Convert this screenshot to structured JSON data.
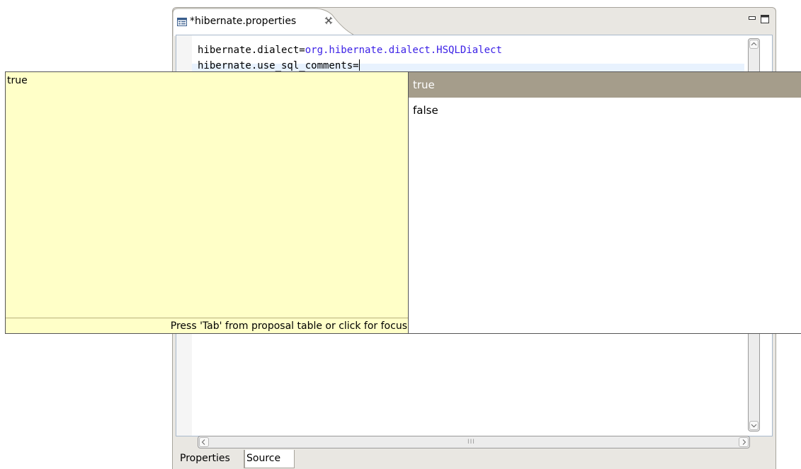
{
  "editor": {
    "tab_title": "*hibernate.properties",
    "code": [
      {
        "key": "hibernate.dialect=",
        "value": "org.hibernate.dialect.HSQLDialect"
      },
      {
        "key": "hibernate.use_sql_comments=",
        "value": ""
      }
    ],
    "bottom_tabs": [
      "Properties",
      "Source"
    ],
    "active_bottom_tab": "Source",
    "hscroll_grip": "III"
  },
  "info_popup": {
    "text": "true",
    "footer": "Press 'Tab' from proposal table or click for focus"
  },
  "proposals": {
    "items": [
      "true",
      "false"
    ],
    "selected_index": 0,
    "selected_color": "#a59d8b"
  },
  "colors": {
    "value_text": "#3a1fe6",
    "popup_bg": "#ffffc8"
  }
}
